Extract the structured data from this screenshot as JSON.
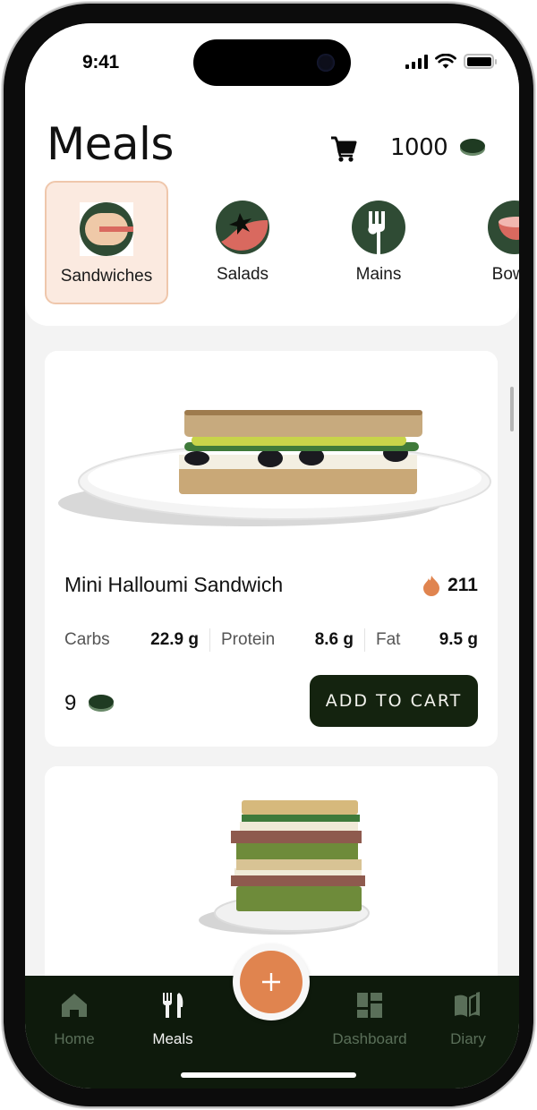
{
  "status_bar": {
    "time": "9:41"
  },
  "header": {
    "title": "Meals",
    "cart_icon": "shopping-cart-icon",
    "coin_balance": "1000",
    "coin_icon": "coin-icon"
  },
  "categories": [
    {
      "label": "Sandwiches",
      "icon": "sandwich-icon",
      "active": true
    },
    {
      "label": "Salads",
      "icon": "tomato-icon",
      "active": false
    },
    {
      "label": "Mains",
      "icon": "fork-icon",
      "active": false
    },
    {
      "label": "Bowls",
      "icon": "bowl-icon",
      "active": false
    }
  ],
  "meals": [
    {
      "name": "Mini Halloumi Sandwich",
      "image": "halloumi-sandwich-photo",
      "calories": "211",
      "calorie_icon": "kcal-flame-icon",
      "macros": [
        {
          "label": "Carbs",
          "value": "22.9 g"
        },
        {
          "label": "Protein",
          "value": "8.6 g"
        },
        {
          "label": "Fat",
          "value": "9.5 g"
        }
      ],
      "price": "9",
      "add_button": "ADD TO CART"
    },
    {
      "image": "club-sandwich-photo"
    }
  ],
  "bottom_nav": {
    "items": [
      {
        "label": "Home",
        "icon": "home-icon",
        "active": false
      },
      {
        "label": "Meals",
        "icon": "fork-knife-icon",
        "active": true
      },
      {
        "label": "Dashboard",
        "icon": "dashboard-icon",
        "active": false
      },
      {
        "label": "Diary",
        "icon": "book-icon",
        "active": false
      }
    ],
    "fab_icon": "plus-icon"
  },
  "colors": {
    "brand_dark": "#14230f",
    "nav_bg": "#0e1a0c",
    "accent_orange": "#e0844f",
    "icon_green": "#2f4b34",
    "icon_red": "#d9695f",
    "active_category_bg": "#fbeae0",
    "active_category_border": "#efc7ac"
  }
}
